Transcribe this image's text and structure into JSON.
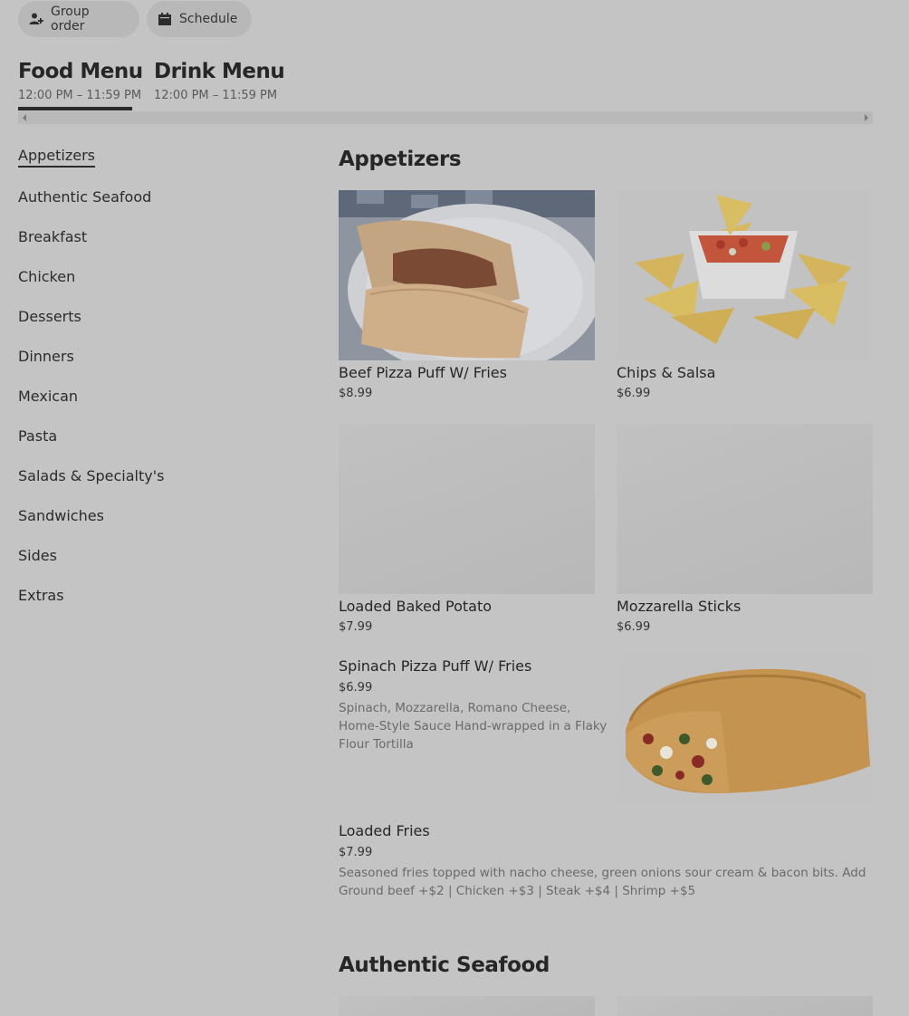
{
  "top_buttons": {
    "group_order": {
      "label": "Group order",
      "icon": "person-add-icon"
    },
    "schedule": {
      "label": "Schedule",
      "icon": "calendar-icon"
    }
  },
  "menus": [
    {
      "name": "Food Menu",
      "hours": "12:00 PM – 11:59 PM",
      "active": true
    },
    {
      "name": "Drink Menu",
      "hours": "12:00 PM – 11:59 PM",
      "active": false
    }
  ],
  "sidebar": {
    "items": [
      {
        "label": "Appetizers",
        "active": true
      },
      {
        "label": "Authentic Seafood"
      },
      {
        "label": "Breakfast"
      },
      {
        "label": "Chicken"
      },
      {
        "label": "Desserts"
      },
      {
        "label": "Dinners"
      },
      {
        "label": "Mexican"
      },
      {
        "label": "Pasta"
      },
      {
        "label": "Salads & Specialty's"
      },
      {
        "label": "Sandwiches"
      },
      {
        "label": "Sides"
      },
      {
        "label": "Extras"
      }
    ]
  },
  "sections": [
    {
      "title": "Appetizers",
      "grid_items": [
        {
          "name": "Beef Pizza Puff W/ Fries",
          "price": "$8.99",
          "image": "pizza-puff-photo"
        },
        {
          "name": "Chips & Salsa",
          "price": "$6.99",
          "image": "chips-salsa-photo"
        },
        {
          "name": "Loaded Baked Potato",
          "price": "$7.99",
          "image": "placeholder"
        },
        {
          "name": "Mozzarella Sticks",
          "price": "$6.99",
          "image": "placeholder"
        }
      ],
      "list_items": [
        {
          "name": "Spinach Pizza Puff W/ Fries",
          "price": "$6.99",
          "description": "Spinach, Mozzarella, Romano Cheese, Home-Style Sauce Hand-wrapped in a Flaky Flour Tortilla",
          "image": "spinach-puff-photo"
        },
        {
          "name": "Loaded Fries",
          "price": "$7.99",
          "description": "Seasoned fries topped with nacho cheese, green onions sour cream & bacon bits. Add Ground beef +$2 | Chicken +$3 | Steak +$4 | Shrimp +$5"
        }
      ]
    },
    {
      "title": "Authentic Seafood"
    }
  ]
}
